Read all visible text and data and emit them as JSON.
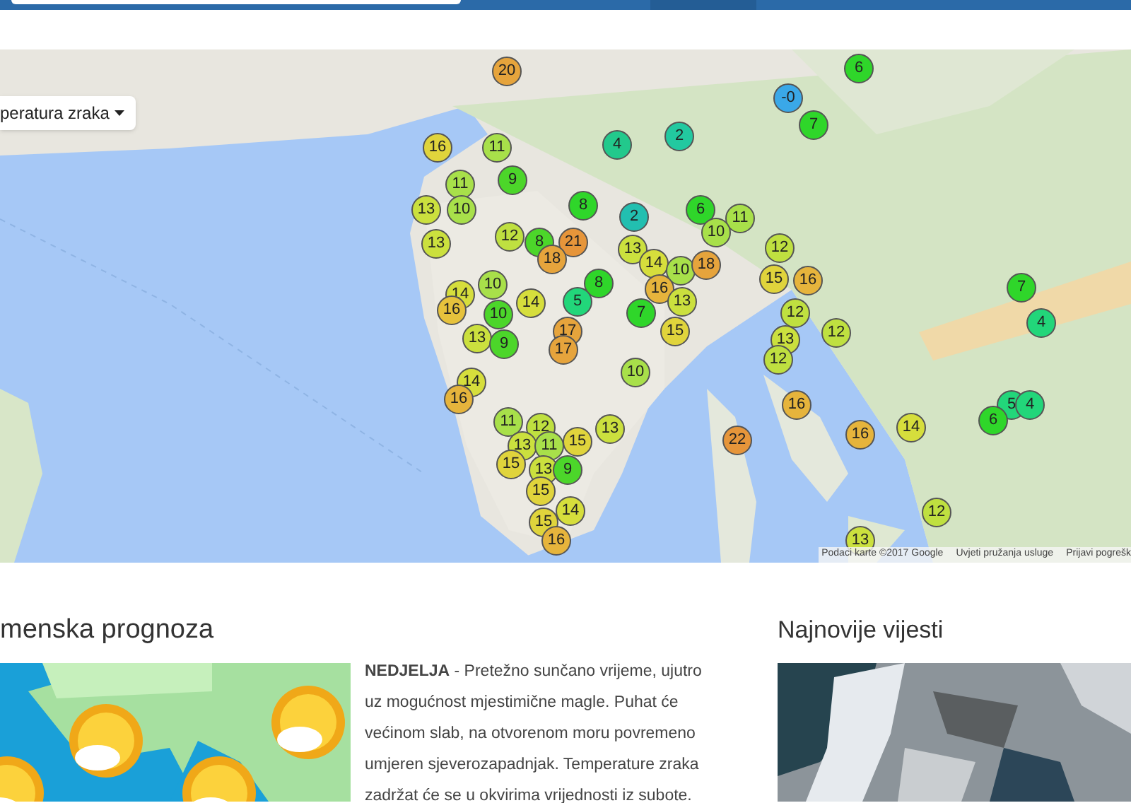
{
  "map": {
    "layer_select": {
      "label": "peratura zraka"
    },
    "markers": [
      {
        "value": "20",
        "color": "#e6a43c"
      },
      {
        "value": "6",
        "color": "#2fd62a"
      },
      {
        "value": "-0",
        "color": "#3aa8e8"
      },
      {
        "value": "7",
        "color": "#2fd62a"
      },
      {
        "value": "16",
        "color": "#e0d43c"
      },
      {
        "value": "11",
        "color": "#a8e04a"
      },
      {
        "value": "4",
        "color": "#22c98c"
      },
      {
        "value": "2",
        "color": "#22c9a0"
      },
      {
        "value": "11",
        "color": "#a8e04a"
      },
      {
        "value": "9",
        "color": "#4cd62a"
      },
      {
        "value": "13",
        "color": "#cbe03e"
      },
      {
        "value": "10",
        "color": "#a8e04a"
      },
      {
        "value": "8",
        "color": "#2fd62a"
      },
      {
        "value": "2",
        "color": "#22bfb0"
      },
      {
        "value": "6",
        "color": "#2fd62a"
      },
      {
        "value": "11",
        "color": "#a8e04a"
      },
      {
        "value": "13",
        "color": "#cbe03e"
      },
      {
        "value": "12",
        "color": "#bfe040"
      },
      {
        "value": "8",
        "color": "#4cd62a"
      },
      {
        "value": "21",
        "color": "#e6953a"
      },
      {
        "value": "10",
        "color": "#a8e04a"
      },
      {
        "value": "18",
        "color": "#e6a43c"
      },
      {
        "value": "13",
        "color": "#cbe03e"
      },
      {
        "value": "12",
        "color": "#bfe040"
      },
      {
        "value": "14",
        "color": "#d6de3c"
      },
      {
        "value": "10",
        "color": "#a8e04a"
      },
      {
        "value": "18",
        "color": "#e6a43c"
      },
      {
        "value": "10",
        "color": "#a8e04a"
      },
      {
        "value": "8",
        "color": "#2fd62a"
      },
      {
        "value": "16",
        "color": "#e6b43c"
      },
      {
        "value": "15",
        "color": "#e0d43c"
      },
      {
        "value": "16",
        "color": "#e6b43c"
      },
      {
        "value": "7",
        "color": "#2fd62a"
      },
      {
        "value": "14",
        "color": "#d6de3c"
      },
      {
        "value": "14",
        "color": "#d6de3c"
      },
      {
        "value": "5",
        "color": "#22d67a"
      },
      {
        "value": "13",
        "color": "#cbe03e"
      },
      {
        "value": "16",
        "color": "#e6c23c"
      },
      {
        "value": "10",
        "color": "#4cd62a"
      },
      {
        "value": "7",
        "color": "#2fd62a"
      },
      {
        "value": "12",
        "color": "#bfe040"
      },
      {
        "value": "17",
        "color": "#e6a43c"
      },
      {
        "value": "15",
        "color": "#e0d43c"
      },
      {
        "value": "12",
        "color": "#bfe040"
      },
      {
        "value": "4",
        "color": "#22d67a"
      },
      {
        "value": "13",
        "color": "#cbe03e"
      },
      {
        "value": "9",
        "color": "#4cd62a"
      },
      {
        "value": "17",
        "color": "#e6a43c"
      },
      {
        "value": "13",
        "color": "#cbe03e"
      },
      {
        "value": "12",
        "color": "#bfe040"
      },
      {
        "value": "10",
        "color": "#a8e04a"
      },
      {
        "value": "14",
        "color": "#d6de3c"
      },
      {
        "value": "16",
        "color": "#e6b43c"
      },
      {
        "value": "16",
        "color": "#e6b43c"
      },
      {
        "value": "5",
        "color": "#22d67a"
      },
      {
        "value": "4",
        "color": "#22d67a"
      },
      {
        "value": "11",
        "color": "#a8e04a"
      },
      {
        "value": "12",
        "color": "#bfe040"
      },
      {
        "value": "13",
        "color": "#cbe03e"
      },
      {
        "value": "14",
        "color": "#d6de3c"
      },
      {
        "value": "6",
        "color": "#2fd62a"
      },
      {
        "value": "13",
        "color": "#cbe03e"
      },
      {
        "value": "11",
        "color": "#a8e04a"
      },
      {
        "value": "15",
        "color": "#e0d43c"
      },
      {
        "value": "22",
        "color": "#e6953a"
      },
      {
        "value": "16",
        "color": "#e6b43c"
      },
      {
        "value": "15",
        "color": "#e0d43c"
      },
      {
        "value": "13",
        "color": "#cbe03e"
      },
      {
        "value": "9",
        "color": "#4cd62a"
      },
      {
        "value": "15",
        "color": "#e0d43c"
      },
      {
        "value": "15",
        "color": "#e0d43c"
      },
      {
        "value": "14",
        "color": "#d6de3c"
      },
      {
        "value": "12",
        "color": "#bfe040"
      },
      {
        "value": "16",
        "color": "#e6b43c"
      },
      {
        "value": "13",
        "color": "#cbe03e"
      }
    ],
    "attribution": [
      "Podaci karte ©2017 Google",
      "Uvjeti pružanja usluge",
      "Prijavi pogrešk"
    ]
  },
  "forecast": {
    "heading": "menska prognoza",
    "text": "**NEDJELJA** - Pretežno sunčano vrijeme, ujutro uz mogućnost mjestimične magle. Puhat će većinom slab, na otvorenom moru povremeno umjeren sjeverozapadnjak. Temperature zraka zadržat će se u okvirima vrijednosti iz subote."
  },
  "news": {
    "heading": "Najnovije vijesti"
  }
}
